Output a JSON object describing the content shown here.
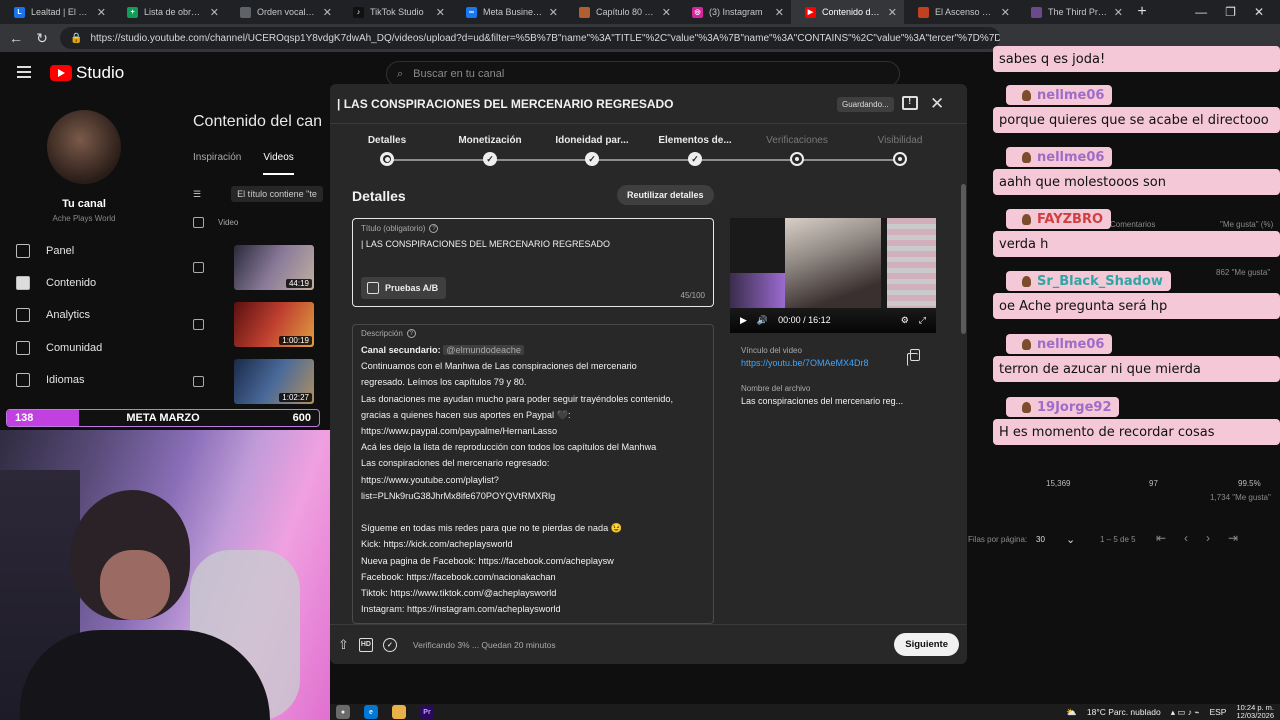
{
  "browser": {
    "tabs": [
      {
        "label": "Lealtad | El mejor sof",
        "color": "#1a73e8",
        "glyph": "L",
        "active": false
      },
      {
        "label": "Lista de obras en seg",
        "color": "#0f9d58",
        "glyph": "+",
        "active": false
      },
      {
        "label": "Orden vocal y silaba",
        "color": "#5f6368",
        "glyph": "",
        "active": false
      },
      {
        "label": "TikTok Studio",
        "color": "#111111",
        "glyph": "♪",
        "active": false
      },
      {
        "label": "Meta Business Suite",
        "color": "#1877f2",
        "glyph": "∞",
        "active": false
      },
      {
        "label": "Capítulo 80 de Las",
        "color": "#b06030",
        "glyph": "",
        "active": false
      },
      {
        "label": "(3) Instagram",
        "color": "#d6249f",
        "glyph": "◎",
        "active": false
      },
      {
        "label": "Contenido del canal",
        "color": "#ff0000",
        "glyph": "▶",
        "active": true
      },
      {
        "label": "El Ascenso del Terce",
        "color": "#c04020",
        "glyph": "",
        "active": false
      },
      {
        "label": "The Third Prince of t",
        "color": "#6a4a8a",
        "glyph": "",
        "active": false
      }
    ],
    "url": "https://studio.youtube.com/channel/UCEROqsp1Y8vdgK7dwAh_DQ/videos/upload?d=ud&filter=%5B%7B\"name\"%3A\"TITLE\"%2C\"value\"%3A%7B\"name\"%3A\"CONTAINS\"%2C\"value\"%3A\"tercer\"%7D%7D%5D&..."
  },
  "studio": {
    "logo_text": "Studio",
    "search_placeholder": "Buscar en tu canal",
    "channel_label": "Tu canal",
    "channel_name": "Ache Plays World",
    "nav": [
      {
        "label": "Panel",
        "name": "sidebar-item-panel"
      },
      {
        "label": "Contenido",
        "name": "sidebar-item-contenido",
        "active": true
      },
      {
        "label": "Analytics",
        "name": "sidebar-item-analytics"
      },
      {
        "label": "Comunidad",
        "name": "sidebar-item-comunidad"
      },
      {
        "label": "Idiomas",
        "name": "sidebar-item-idiomas"
      }
    ],
    "content_title": "Contenido del can",
    "tab_inspiracion": "Inspiración",
    "tab_videos": "Videos",
    "filter_chip": "El título contiene \"te",
    "col_video": "Video",
    "durations": [
      "44:19",
      "1:00:19",
      "1:02:27"
    ],
    "bg_comments": "Comentarios",
    "bg_likes_pct": "\"Me gusta\" (%)",
    "bg_likes_count": "862 \"Me gusta\"",
    "bg_views": "15,369",
    "bg_comments_n": "97",
    "bg_pct": "99.5%",
    "bg_likes2": "1,734 \"Me gusta\"",
    "rows_per_page": "Filas por página:",
    "rows_value": "30",
    "range": "1 – 5 de 5"
  },
  "meta_bar": {
    "left": "138",
    "label": "META MARZO",
    "right": "600",
    "progress": 0.23
  },
  "modal": {
    "title": "| LAS CONSPIRACIONES DEL MERCENARIO REGRESADO",
    "saving": "Guardando...",
    "steps": [
      {
        "label": "Detalles",
        "state": "current"
      },
      {
        "label": "Monetización",
        "state": "done"
      },
      {
        "label": "Idoneidad par...",
        "state": "done"
      },
      {
        "label": "Elementos de...",
        "state": "done"
      },
      {
        "label": "Verificaciones",
        "state": "pending"
      },
      {
        "label": "Visibilidad",
        "state": "pending"
      }
    ],
    "details_heading": "Detalles",
    "reuse_button": "Reutilizar detalles",
    "title_label": "Título (obligatorio)",
    "title_value": "| LAS CONSPIRACIONES DEL MERCENARIO REGRESADO",
    "ab_button": "Pruebas A/B",
    "char_count": "45/100",
    "desc_label": "Descripción",
    "desc_secondary_label": "Canal secundario:",
    "desc_mention": "@elmundodeache",
    "desc_lines": [
      "Continuamos con el Manhwa de Las conspiraciones del mercenario",
      "regresado. Leímos los capítulos 79 y 80.",
      "Las donaciones me ayudan mucho para poder seguir trayéndoles contenido,",
      "gracias a quienes hacen sus aportes en Paypal 🖤:",
      "https://www.paypal.com/paypalme/HernanLasso",
      "Acá les dejo la lista de reproducción con todos los capítulos del Manhwa",
      "Las conspiraciones del mercenario regresado:",
      "https://www.youtube.com/playlist?",
      "list=PLNk9ruG38JhrMx8ife670POYQVtRMXRlg",
      "",
      "Sígueme en todas mis redes para que no te pierdas de nada 😉",
      "Kick: https://kick.com/acheplaysworld",
      "Nueva pagina de Facebook: https://facebook.com/acheplaysw",
      "Facebook: https://facebook.com/nacionakachan",
      "Tiktok: https://www.tiktok.com/@acheplaysworld",
      "Instagram: https://instagram.com/acheplaysworld"
    ],
    "player_time": "00:00 / 16:12",
    "link_label": "Vínculo del video",
    "link_value": "https://youtu.be/7OMAeMX4Dr8",
    "file_label": "Nombre del archivo",
    "file_value": "Las conspiraciones del mercenario reg...",
    "footer_hd": "HD",
    "verify_text": "Verificando 3% ... Quedan 20 minutos",
    "next_button": "Siguiente"
  },
  "chat": {
    "top_text": "sabes q es joda!",
    "messages": [
      {
        "user": "nellme06",
        "text": "porque quieres que se acabe el directooo",
        "style": "fancy"
      },
      {
        "user": "nellme06",
        "text": "aahh que molestooos son",
        "style": "fancy"
      },
      {
        "user": "FAYZBRO",
        "text": "verda h",
        "style": "red"
      },
      {
        "user": "Sr_Black_Shadow",
        "text": "oe Ache pregunta será hp",
        "style": "teal"
      },
      {
        "user": "nellme06",
        "text": "terron de azucar ni que mierda",
        "style": "fancy"
      },
      {
        "user": "19Jorge92",
        "text": "H es momento de recordar cosas",
        "style": "fancy"
      }
    ]
  },
  "taskbar": {
    "weather": "18°C  Parc. nublado",
    "lang": "ESP",
    "time": "10:24 p. m.",
    "date": "12/03/2026"
  }
}
